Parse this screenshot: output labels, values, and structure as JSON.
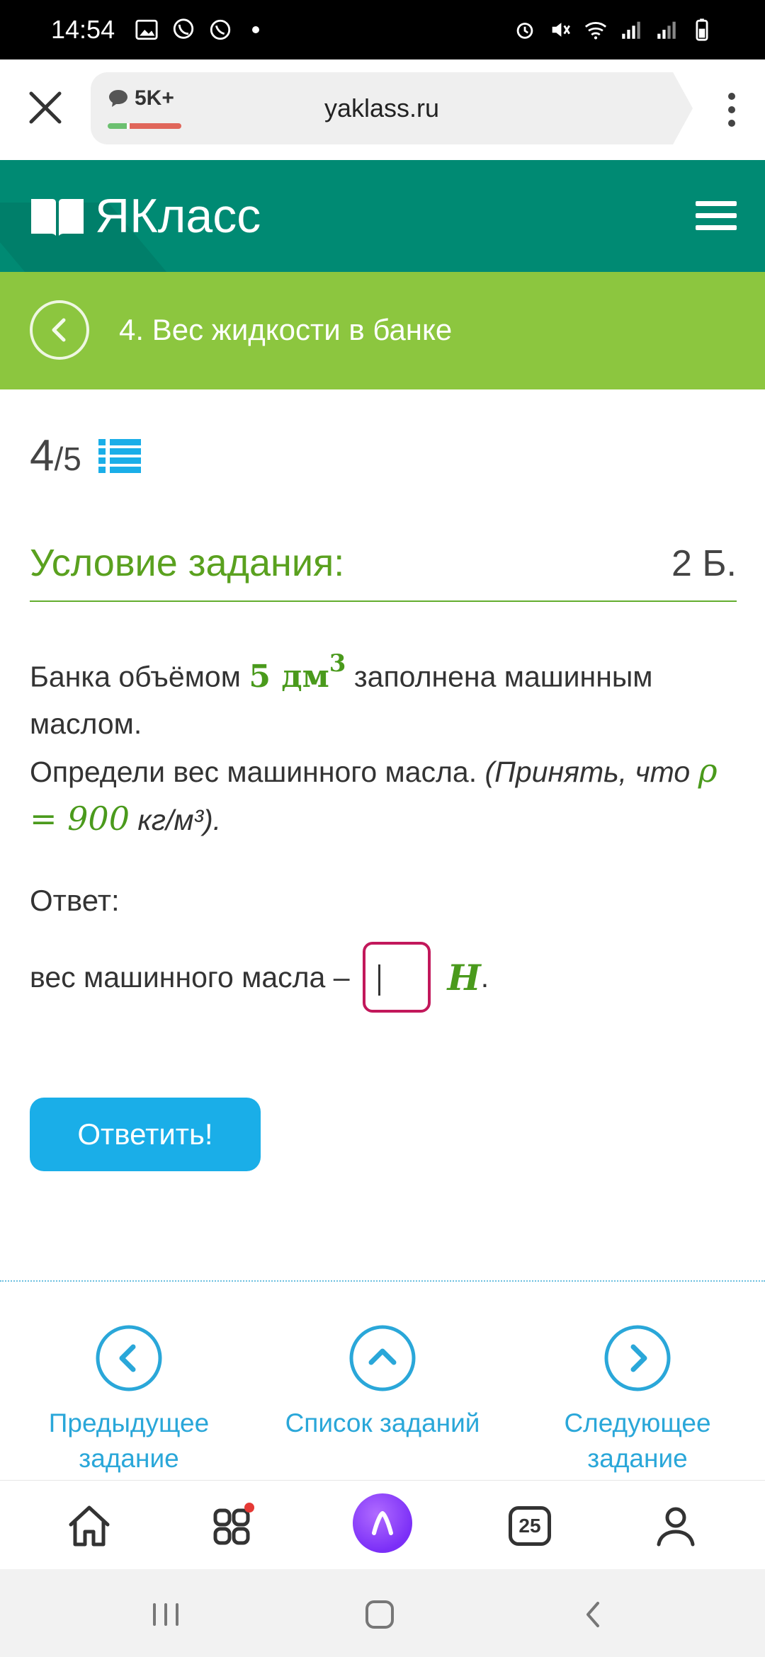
{
  "status_bar": {
    "time": "14:54"
  },
  "browser": {
    "comments_count": "5K+",
    "url": "yaklass.ru"
  },
  "site": {
    "logo_text": "ЯКласс"
  },
  "topic": {
    "title": "4. Вес жидкости в банке"
  },
  "progress": {
    "current": "4",
    "total": "/5"
  },
  "condition": {
    "title": "Условие задания:",
    "points": "2 Б."
  },
  "task": {
    "line1_pre": "Банка объёмом ",
    "volume_value": "5 дм",
    "volume_exp": "3",
    "line1_post": " заполнена машинным маслом.",
    "line2_pre": "Определи вес машинного масла. ",
    "hint_pre": "(Принять, что ",
    "rho_expr": "ρ = 900",
    "hint_unit": " кг/м³).",
    "answer_label": "Ответ:",
    "answer_prefix": "вес машинного масла –",
    "answer_unit": "Н",
    "answer_suffix": "."
  },
  "submit": {
    "label": "Ответить!"
  },
  "task_nav": {
    "prev_line1": "Предыдущее",
    "prev_line2": "задание",
    "list_label": "Список заданий",
    "next_line1": "Следующее",
    "next_line2": "задание"
  },
  "toolbar": {
    "tabs_count": "25"
  },
  "icons": {
    "close": "close-icon",
    "menu": "more-vertical-icon",
    "hamburger": "hamburger-icon",
    "back": "chevron-left-icon",
    "list": "list-icon"
  },
  "colors": {
    "header": "#008a73",
    "topic_bar": "#8cc63f",
    "accent_green": "#5aa11f",
    "link_blue": "#2aa7d9",
    "button_blue": "#1aaee8",
    "input_border": "#c2185b"
  }
}
